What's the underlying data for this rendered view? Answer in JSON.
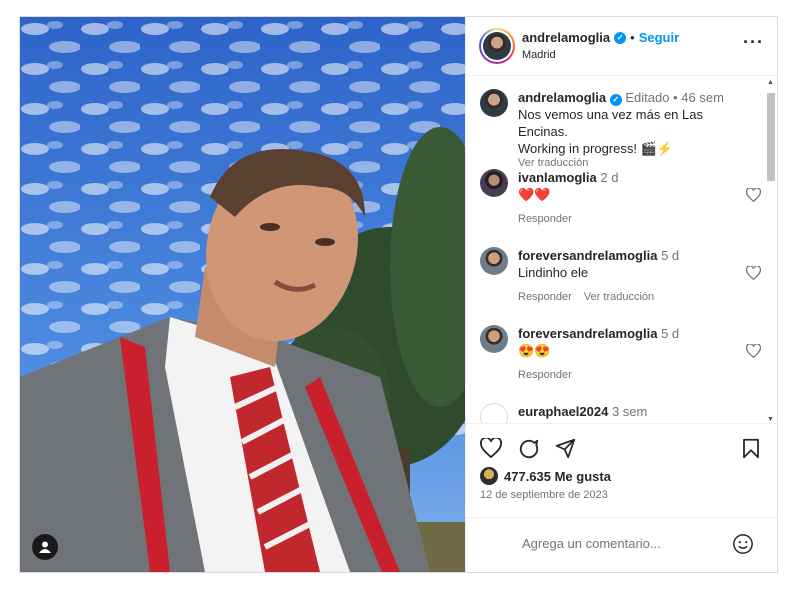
{
  "post": {
    "header": {
      "username": "andrelamoglia",
      "verified_icon": "verified-badge-icon",
      "separator": "•",
      "follow_label": "Seguir",
      "location": "Madrid",
      "more_icon": "more-options-icon"
    },
    "caption": {
      "username": "andrelamoglia",
      "edited": "Editado",
      "separator": "•",
      "time": "46 sem",
      "text_line1": "Nos vemos una vez más en Las Encinas.",
      "text_line2": "Working in progress! 🎬⚡",
      "translate": "Ver traducción"
    },
    "comments": [
      {
        "username": "ivanlamoglia",
        "time": "2 d",
        "text": "❤️❤️",
        "reply": "Responder",
        "translate": ""
      },
      {
        "username": "foreversandrelamoglia",
        "time": "5 d",
        "text": "Lindinho ele",
        "reply": "Responder",
        "translate": "Ver traducción"
      },
      {
        "username": "foreversandrelamoglia",
        "time": "5 d",
        "text": "😍😍",
        "reply": "Responder",
        "translate": ""
      },
      {
        "username": "euraphael2024",
        "time": "3 sem",
        "text": "",
        "reply": "",
        "translate": ""
      }
    ],
    "likes": "477.635 Me gusta",
    "date": "12 de septiembre de 2023",
    "add_comment_placeholder": "Agrega un comentario...",
    "icons": {
      "like": "heart-icon",
      "comment": "comment-icon",
      "share": "share-icon",
      "save": "bookmark-icon",
      "emoji": "emoji-icon",
      "user_tag": "user-tag-icon"
    },
    "colors": {
      "accent": "#0095f6",
      "text": "#262626",
      "muted": "#737373",
      "heart_red": "#ed4956",
      "sky": "#2f6fd4"
    }
  }
}
